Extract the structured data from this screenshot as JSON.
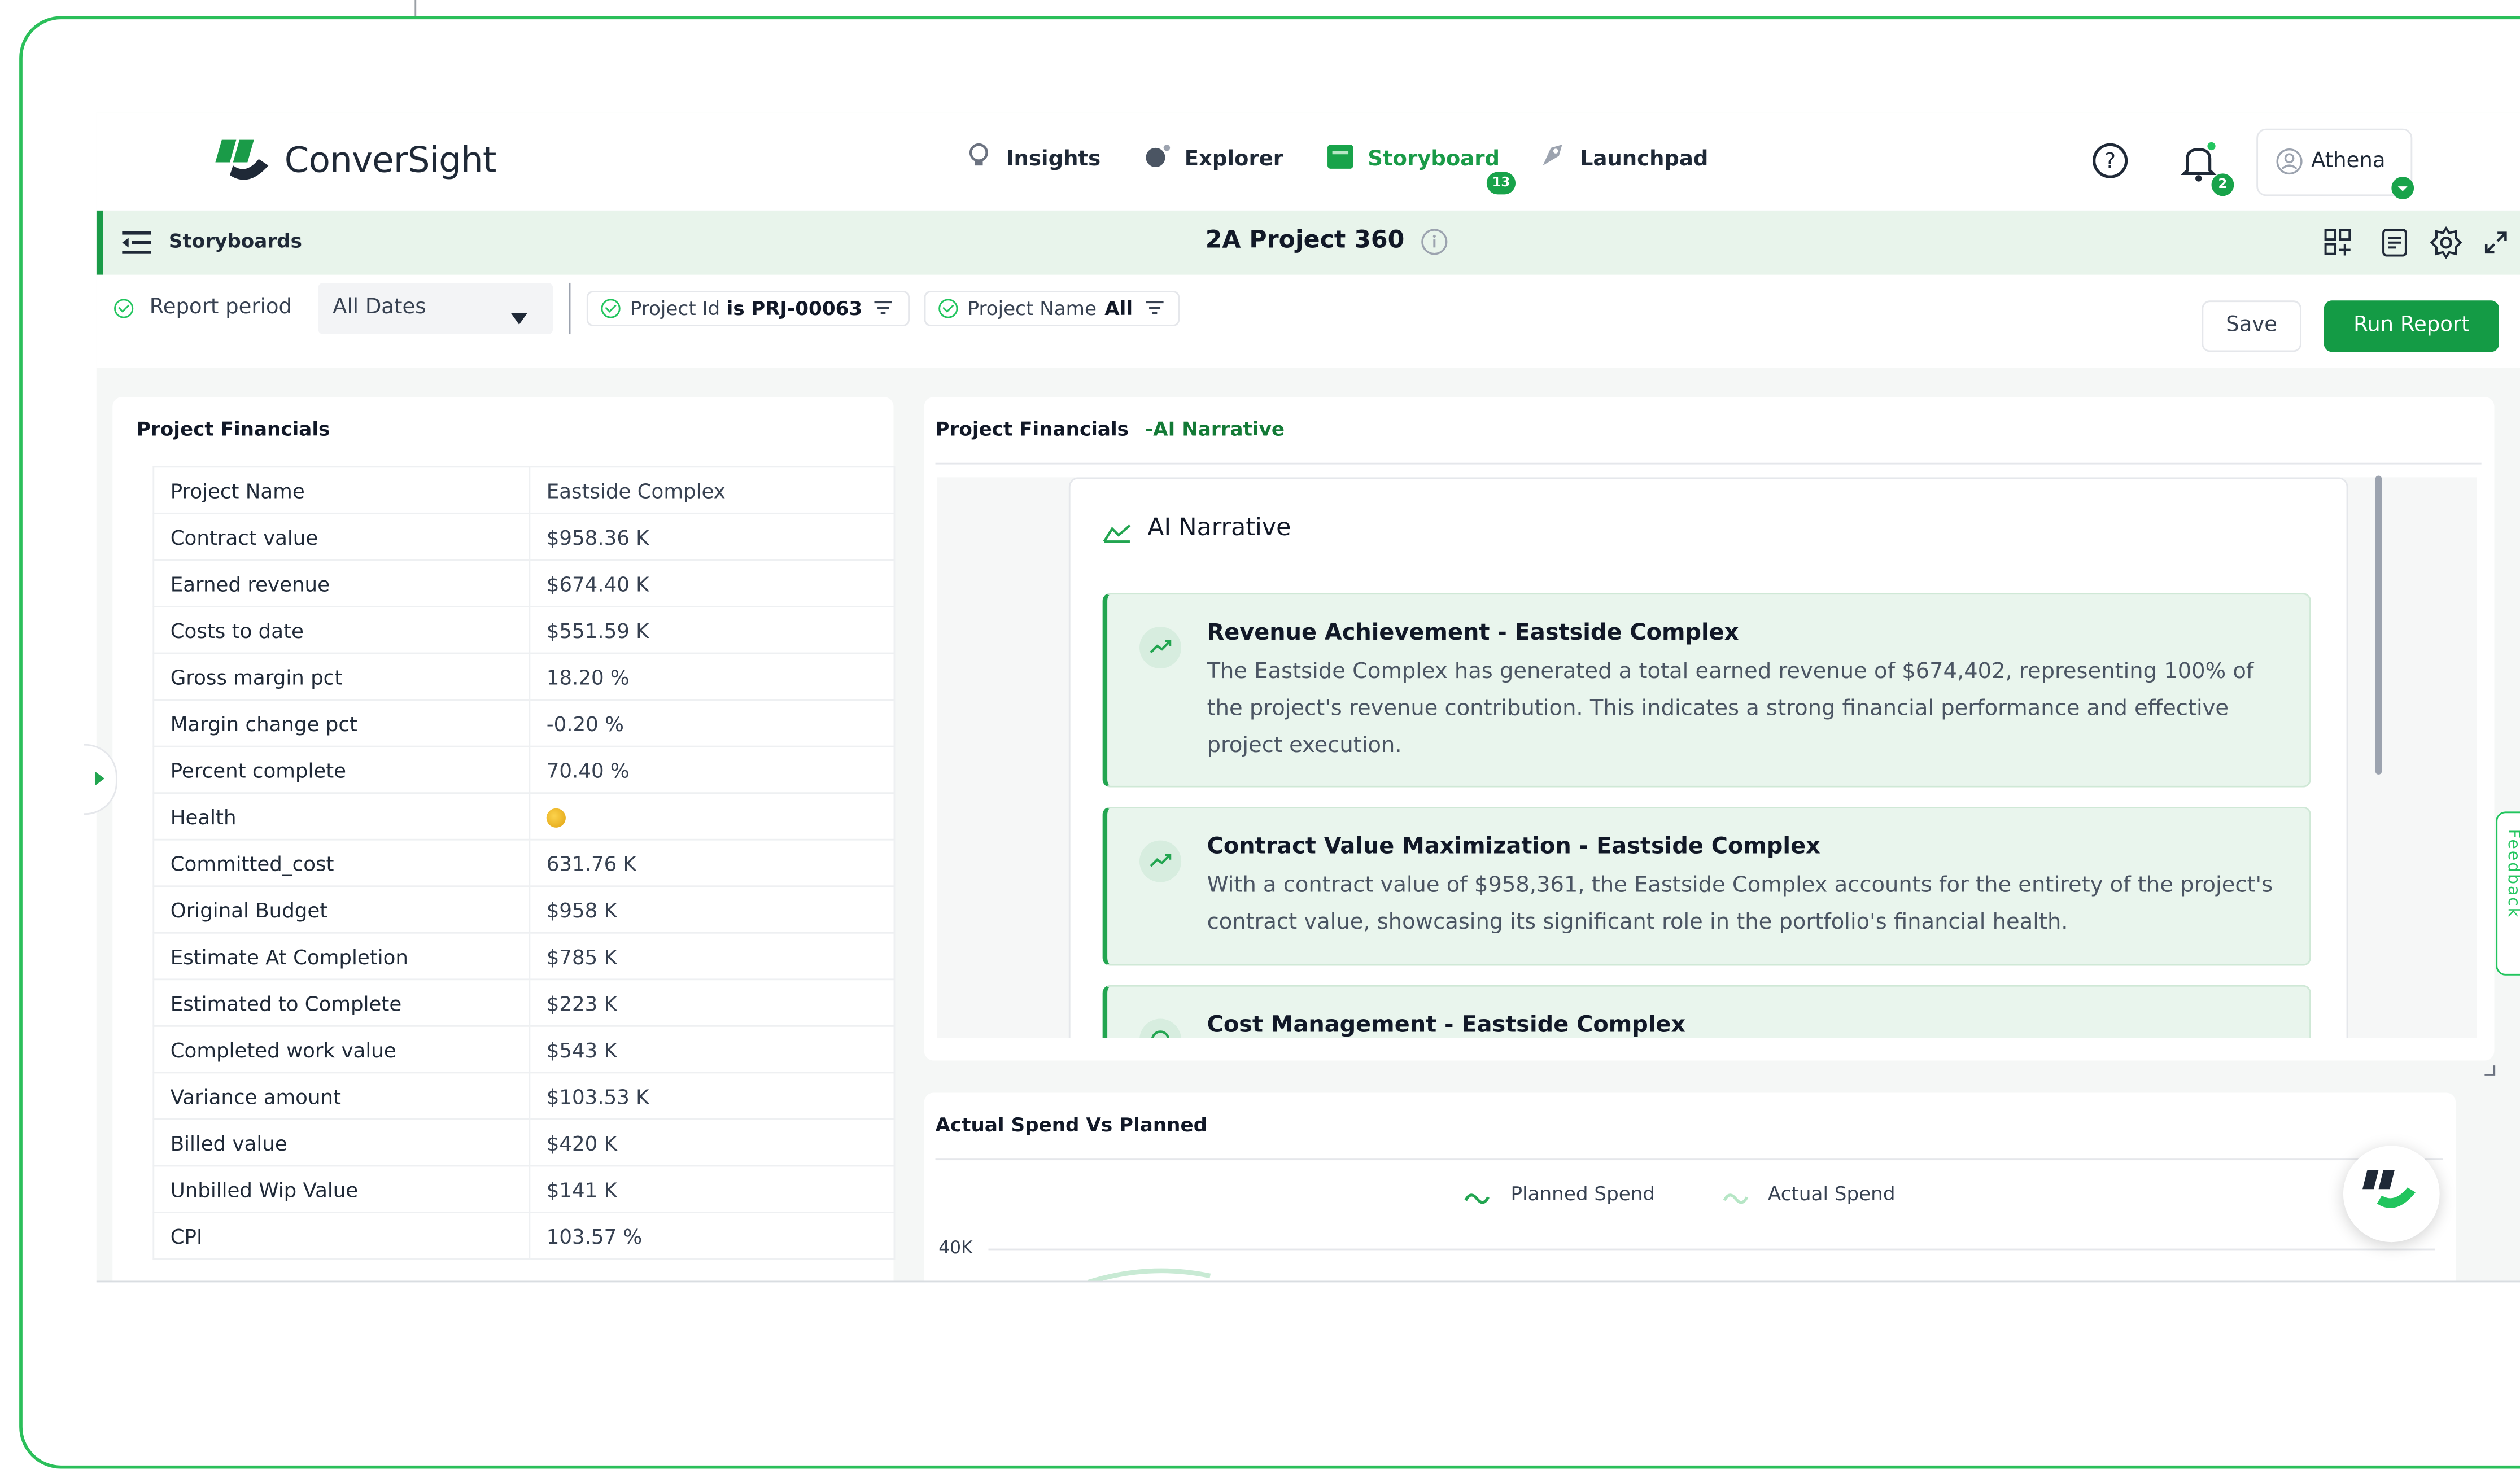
{
  "brand": {
    "logo_text": "ConverSight"
  },
  "nav": [
    {
      "label": "Insights",
      "icon": "bulb-icon"
    },
    {
      "label": "Explorer",
      "icon": "explore-icon"
    },
    {
      "label": "Storyboard",
      "icon": "storyboard-icon",
      "badge": "13",
      "active": true
    },
    {
      "label": "Launchpad",
      "icon": "rocket-icon"
    }
  ],
  "header": {
    "notification_count": "2",
    "user_name": "Athena"
  },
  "toolbar": {
    "section_label": "Storyboards",
    "page_title": "2A Project 360"
  },
  "filters": {
    "report_period_label": "Report period",
    "report_period_value": "All Dates",
    "project_id_label": "Project Id",
    "project_id_op": "is",
    "project_id_value": "PRJ-00063",
    "project_name_label": "Project Name",
    "project_name_value": "All",
    "save_label": "Save",
    "run_label": "Run Report"
  },
  "financials": {
    "title": "Project Financials",
    "rows": [
      {
        "label": "Project Name",
        "value": "Eastside Complex"
      },
      {
        "label": "Contract value",
        "value": "$958.36 K"
      },
      {
        "label": "Earned revenue",
        "value": "$674.40 K"
      },
      {
        "label": "Costs to date",
        "value": "$551.59 K"
      },
      {
        "label": "Gross margin pct",
        "value": "18.20 %"
      },
      {
        "label": "Margin change pct",
        "value": "-0.20 %"
      },
      {
        "label": "Percent complete",
        "value": "70.40 %"
      },
      {
        "label": "Health",
        "value": ""
      },
      {
        "label": "Committed_cost",
        "value": "631.76 K"
      },
      {
        "label": "Original Budget",
        "value": "$958 K"
      },
      {
        "label": "Estimate At Completion",
        "value": "$785 K"
      },
      {
        "label": "Estimated to Complete",
        "value": "$223 K"
      },
      {
        "label": "Completed work value",
        "value": "$543 K"
      },
      {
        "label": "Variance amount",
        "value": "$103.53 K"
      },
      {
        "label": "Billed value",
        "value": "$420 K"
      },
      {
        "label": "Unbilled Wip Value",
        "value": "$141 K"
      },
      {
        "label": "CPI",
        "value": "103.57 %"
      }
    ]
  },
  "narrative": {
    "title_main": "Project Financials",
    "title_suffix": "-AI Narrative",
    "heading": "AI Narrative",
    "insights": [
      {
        "title": "Revenue Achievement - Eastside Complex",
        "body": "The Eastside Complex has generated a total earned revenue of $674,402, representing 100% of the project's revenue contribution. This indicates a strong financial performance and effective project execution."
      },
      {
        "title": "Contract Value Maximization - Eastside Complex",
        "body": "With a contract value of $958,361, the Eastside Complex accounts for the entirety of the project's contract value, showcasing its significant role in the portfolio's financial health."
      },
      {
        "title": "Cost Management - Eastside Complex",
        "body": ""
      }
    ]
  },
  "spend_chart": {
    "title": "Actual Spend Vs Planned",
    "legend": [
      "Planned Spend",
      "Actual Spend"
    ],
    "tick_40k": "40K"
  },
  "feedback_label": "Feedback",
  "colors": {
    "accent": "#149b45",
    "toolbar_bg": "#e8f4eb",
    "insight_bg": "#e9f5ed"
  }
}
